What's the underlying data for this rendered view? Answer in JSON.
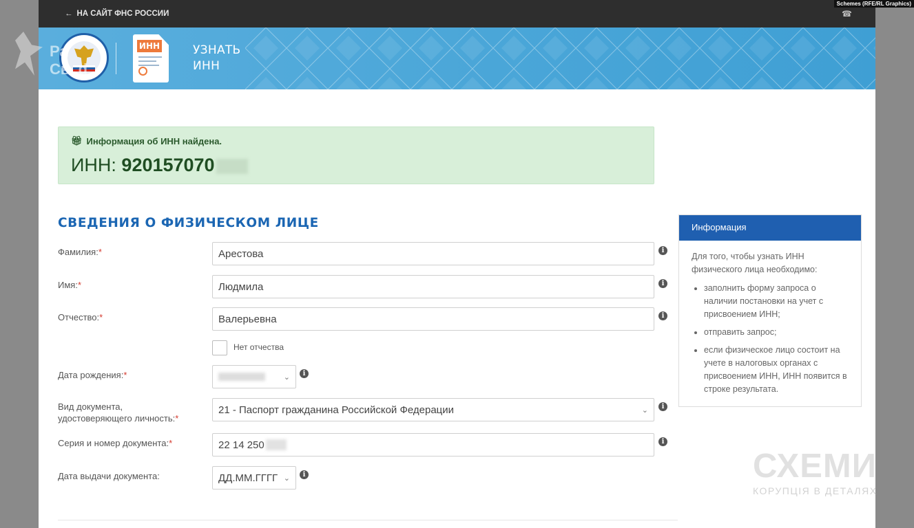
{
  "credit": "Schemes (RFE/RL Graphics)",
  "topbar": {
    "back_label": "НА САЙТ ФНС РОССИИ",
    "back_icon": "arrow-left-icon",
    "phone_icon": "phone-icon"
  },
  "banner": {
    "title_line1": "УЗНАТЬ",
    "title_line2": "ИНН",
    "doc_tag": "ИНН"
  },
  "watermark_rs": {
    "line1": "Ра",
    "line2": "Св..d"
  },
  "alert": {
    "message": "Информация об ИНН найдена.",
    "inn_label": "ИНН:",
    "inn_value": "920157070",
    "icon": "gift-icon"
  },
  "section_title": "СВЕДЕНИЯ О ФИЗИЧЕСКОМ ЛИЦЕ",
  "form": {
    "surname": {
      "label": "Фамилия:",
      "value": "Арестова"
    },
    "name": {
      "label": "Имя:",
      "value": "Людмила"
    },
    "patronymic": {
      "label": "Отчество:",
      "value": "Валерьевна"
    },
    "no_patronymic_label": "Нет отчества",
    "birth_date": {
      "label": "Дата рождения:"
    },
    "doc_type": {
      "label_line1": "Вид документа,",
      "label_line2": "удостоверяющего личность:",
      "value": "21 - Паспорт гражданина Российской Федерации"
    },
    "doc_number": {
      "label": "Серия и номер документа:",
      "value": "22 14 250"
    },
    "issue_date": {
      "label": "Дата выдачи документа:",
      "placeholder": "ДД.ММ.ГГГГ"
    },
    "required_mark": "*",
    "info_symbol": "i",
    "chevron": "⌄"
  },
  "side_panel": {
    "title": "Информация",
    "intro": "Для того, чтобы узнать ИНН физического лица необходимо:",
    "items": [
      "заполнить форму запроса о наличии постановки на учет с присвоением ИНН;",
      "отправить запрос;",
      "если физическое лицо состоит на учете в налоговых органах с присвоением ИНН, ИНН появится в строке результата."
    ]
  },
  "watermark_schemes": {
    "title": "СХЕМИ",
    "subtitle": "КОРУПЦІЯ В ДЕТАЛЯХ"
  }
}
